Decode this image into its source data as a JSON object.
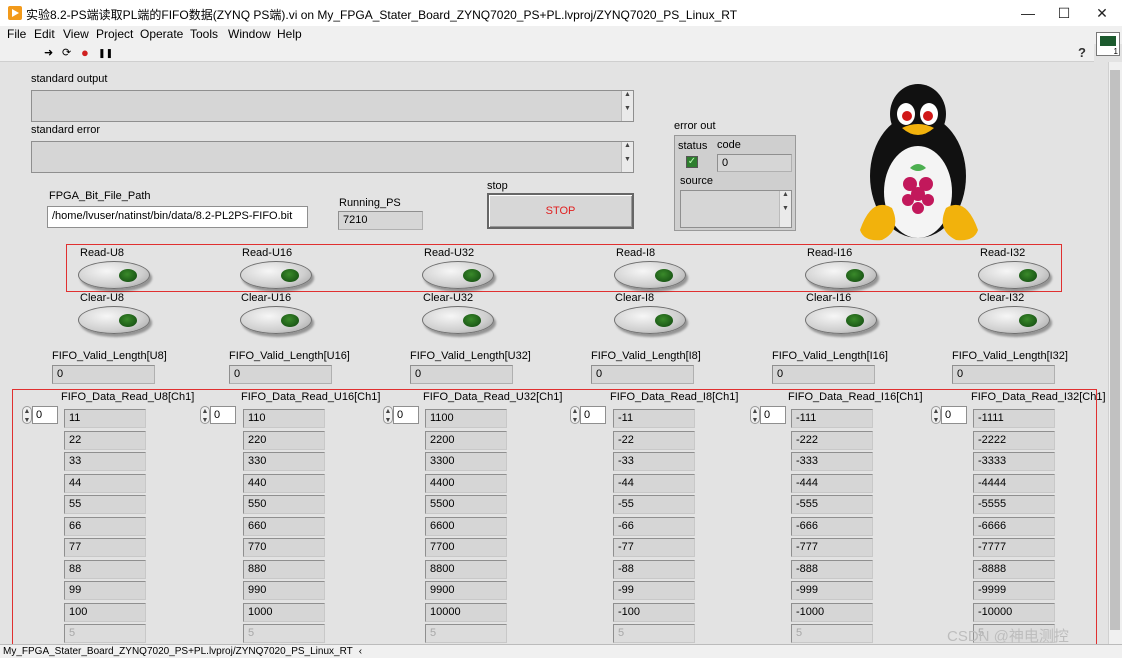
{
  "window": {
    "title": "实验8.2-PS端读取PL端的FIFO数据(ZYNQ PS端).vi on My_FPGA_Stater_Board_ZYNQ7020_PS+PL.lvproj/ZYNQ7020_PS_Linux_RT",
    "minimize": "—",
    "maximize": "☐",
    "close": "✕"
  },
  "menu": [
    "File",
    "Edit",
    "View",
    "Project",
    "Operate",
    "Tools",
    "Window",
    "Help"
  ],
  "toolbar": {
    "run_glyph": "➜",
    "run_cont_glyph": "⟳",
    "abort_glyph": "●",
    "pause_glyph": "❚❚",
    "help_glyph": "?"
  },
  "panel": {
    "stdout_label": "standard output",
    "stderr_label": "standard error",
    "fpga_path_label": "FPGA_Bit_File_Path",
    "fpga_path_value": "/home/lvuser/natinst/bin/data/8.2-PL2PS-FIFO.bit",
    "running_label": "Running_PS",
    "running_value": "7210",
    "stop_label": "stop",
    "stop_button": "STOP",
    "error_out_label": "error out",
    "status_label": "status",
    "status_glyph": "✓",
    "code_label": "code",
    "code_value": "0",
    "source_label": "source"
  },
  "read_buttons": [
    "Read-U8",
    "Read-U16",
    "Read-U32",
    "Read-I8",
    "Read-I16",
    "Read-I32"
  ],
  "clear_buttons": [
    "Clear-U8",
    "Clear-U16",
    "Clear-U32",
    "Clear-I8",
    "Clear-I16",
    "Clear-I32"
  ],
  "valid_lengths": [
    {
      "label": "FIFO_Valid_Length[U8]",
      "value": "0"
    },
    {
      "label": "FIFO_Valid_Length[U16]",
      "value": "0"
    },
    {
      "label": "FIFO_Valid_Length[U32]",
      "value": "0"
    },
    {
      "label": "FIFO_Valid_Length[I8]",
      "value": "0"
    },
    {
      "label": "FIFO_Valid_Length[I16]",
      "value": "0"
    },
    {
      "label": "FIFO_Valid_Length[I32]",
      "value": "0"
    }
  ],
  "arrays": [
    {
      "label": "FIFO_Data_Read_U8[Ch1]",
      "index": "0",
      "values": [
        "11",
        "22",
        "33",
        "44",
        "55",
        "66",
        "77",
        "88",
        "99",
        "100",
        "5"
      ]
    },
    {
      "label": "FIFO_Data_Read_U16[Ch1]",
      "index": "0",
      "values": [
        "110",
        "220",
        "330",
        "440",
        "550",
        "660",
        "770",
        "880",
        "990",
        "1000",
        "5"
      ]
    },
    {
      "label": "FIFO_Data_Read_U32[Ch1]",
      "index": "0",
      "values": [
        "1100",
        "2200",
        "3300",
        "4400",
        "5500",
        "6600",
        "7700",
        "8800",
        "9900",
        "10000",
        "5"
      ]
    },
    {
      "label": "FIFO_Data_Read_I8[Ch1]",
      "index": "0",
      "values": [
        "-11",
        "-22",
        "-33",
        "-44",
        "-55",
        "-66",
        "-77",
        "-88",
        "-99",
        "-100",
        "5"
      ]
    },
    {
      "label": "FIFO_Data_Read_I16[Ch1]",
      "index": "0",
      "values": [
        "-111",
        "-222",
        "-333",
        "-444",
        "-555",
        "-666",
        "-777",
        "-888",
        "-999",
        "-1000",
        "5"
      ]
    },
    {
      "label": "FIFO_Data_Read_I32[Ch1]",
      "index": "0",
      "values": [
        "-1111",
        "-2222",
        "-3333",
        "-4444",
        "-5555",
        "-6666",
        "-7777",
        "-8888",
        "-9999",
        "-10000",
        "5"
      ]
    }
  ],
  "statusbar": "My_FPGA_Stater_Board_ZYNQ7020_PS+PL.lvproj/ZYNQ7020_PS_Linux_RT",
  "watermark": "CSDN @神电测控",
  "colors": {
    "highlight_box": "#e03030",
    "stop_text": "#e02020",
    "led_green": "#1c5a17"
  }
}
